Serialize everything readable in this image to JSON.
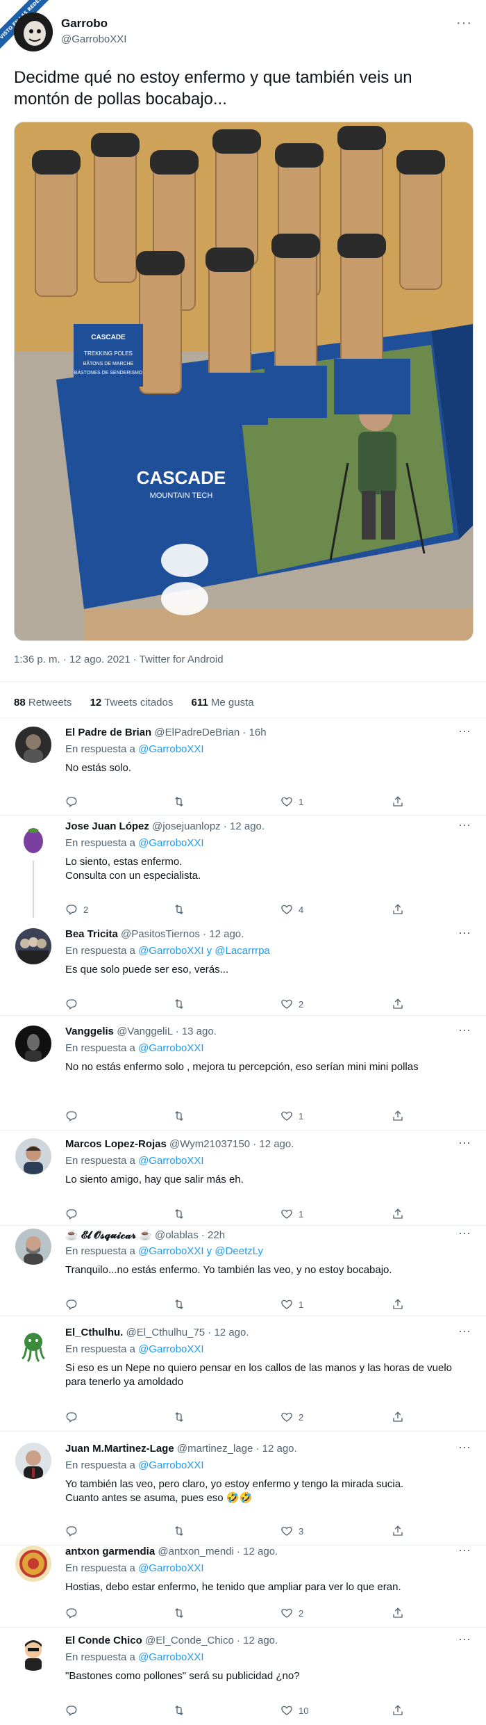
{
  "watermark": "VISTO EN LAS REDES",
  "tweet": {
    "name": "Garrobo",
    "handle": "@GarroboXXI",
    "more": "···",
    "text": "Decidme qué no estoy enfermo y que también veis un montón de pollas bocabajo...",
    "photo_texts": {
      "brand": "CASCADE",
      "brand_sub": "MOUNTAIN TECH",
      "product": "TREKKING POLES",
      "product_fr": "BÂTONS DE MARCHE",
      "product_es": "BASTONES DE SENDERISMO"
    },
    "meta": "1:36 p. m. · 12 ago. 2021 · Twitter for Android",
    "retweets_count": "88",
    "retweets_label": "Retweets",
    "quotes_count": "12",
    "quotes_label": "Tweets citados",
    "likes_count": "611",
    "likes_label": "Me gusta"
  },
  "colors": {
    "link": "#1d9bf0",
    "secondary": "#536471",
    "text": "#0f1419"
  },
  "replies": [
    {
      "name": "El Padre de Brian",
      "handle": "@ElPadreDeBrian · 16h",
      "to_prefix": "En respuesta a",
      "to": "@GarroboXXI",
      "text": "No estás solo.",
      "replies": "",
      "retweets": "",
      "likes": "1",
      "avatar": "dark-portrait"
    },
    {
      "name": "Jose Juan López",
      "handle": "@josejuanlopz · 12 ago.",
      "to_prefix": "En respuesta a",
      "to": "@GarroboXXI",
      "text": "Lo siento, estas enfermo.\nConsulta con un especialista.",
      "replies": "2",
      "retweets": "",
      "likes": "4",
      "avatar": "eggplant"
    },
    {
      "name": "Bea Tricita",
      "handle": "@PasitosTiernos · 12 ago.",
      "to_prefix": "En respuesta a",
      "to": "@GarroboXXI y @Lacarrrpa",
      "text": "Es que solo puede ser eso, verás...",
      "replies": "",
      "retweets": "",
      "likes": "2",
      "avatar": "group"
    },
    {
      "name": "Vanggelis",
      "handle": "@VanggeliL · 13 ago.",
      "to_prefix": "En respuesta a",
      "to": "@GarroboXXI",
      "text": "No no estás enfermo solo , mejora tu percepción, eso serían mini mini pollas",
      "replies": "",
      "retweets": "",
      "likes": "1",
      "avatar": "dark"
    },
    {
      "name": "Marcos Lopez-Rojas",
      "handle": "@Wym21037150 · 12 ago.",
      "to_prefix": "En respuesta a",
      "to": "@GarroboXXI",
      "text": "Lo siento amigo, hay que salir más eh.",
      "replies": "",
      "retweets": "",
      "likes": "1",
      "avatar": "man"
    },
    {
      "name": "☕ 𝓔𝓵 𝓞𝓼𝓺𝓾𝓲𝓬𝓪𝓻 ☕",
      "handle": "@olablas · 22h",
      "to_prefix": "En respuesta a",
      "to": "@GarroboXXI y @DeetzLy",
      "text": "Tranquilo...no estás enfermo. Yo también las veo, y no estoy bocabajo.",
      "replies": "",
      "retweets": "",
      "likes": "1",
      "avatar": "man2"
    },
    {
      "name": "El_Cthulhu.",
      "handle": "@El_Cthulhu_75 · 12 ago.",
      "to_prefix": "En respuesta a",
      "to": "@GarroboXXI",
      "text": "Si eso es un Nepe no quiero pensar en los callos de las manos y las horas de vuelo para tenerlo ya amoldado",
      "replies": "",
      "retweets": "",
      "likes": "2",
      "avatar": "cthulhu"
    },
    {
      "name": "Juan M.Martinez-Lage",
      "handle": "@martinez_lage · 12 ago.",
      "to_prefix": "En respuesta a",
      "to": "@GarroboXXI",
      "text": "Yo también las veo, pero claro, yo estoy enfermo y tengo la mirada sucia.\nCuanto antes se asuma, pues eso 🤣🤣",
      "replies": "",
      "retweets": "",
      "likes": "3",
      "avatar": "man3"
    },
    {
      "name": "antxon garmendia",
      "handle": "@antxon_mendi · 12 ago.",
      "to_prefix": "En respuesta a",
      "to": "@GarroboXXI",
      "text": "Hostias, debo estar enfermo, he tenido que ampliar para ver lo que eran.",
      "replies": "",
      "retweets": "",
      "likes": "2",
      "avatar": "badge"
    },
    {
      "name": "El Conde Chico",
      "handle": "@El_Conde_Chico · 12 ago.",
      "to_prefix": "En respuesta a",
      "to": "@GarroboXXI",
      "text": "\"Bastones como pollones\" será su publicidad ¿no?",
      "replies": "",
      "retweets": "",
      "likes": "10",
      "avatar": "cartoon"
    }
  ]
}
